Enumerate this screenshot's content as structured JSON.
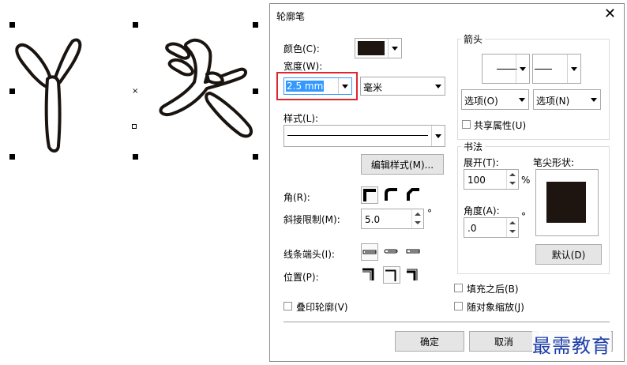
{
  "canvas": {
    "glyphs": [
      "丫",
      "头"
    ]
  },
  "dialog": {
    "title": "轮廓笔",
    "close": "✕"
  },
  "left": {
    "color_label": "颜色(C):",
    "width_label": "宽度(W):",
    "width_value": "2.5 mm",
    "unit_value": "毫米",
    "style_label": "样式(L):",
    "edit_style_button": "编辑样式(M)...",
    "corner_label": "角(R):",
    "miter_label": "斜接限制(M):",
    "miter_value": "5.0",
    "miter_unit": "°",
    "linecap_label": "线条端头(I):",
    "position_label": "位置(P):",
    "overprint_label": "叠印轮廓(V)"
  },
  "arrows": {
    "group_label": "箭头",
    "option_left": "选项(O)",
    "option_right": "选项(N)",
    "share_label": "共享属性(U)"
  },
  "calligraphy": {
    "group_label": "书法",
    "stretch_label": "展开(T):",
    "stretch_value": "100",
    "stretch_unit": "%",
    "angle_label": "角度(A):",
    "angle_value": ".0",
    "angle_unit": "°",
    "nib_label": "笔尖形状:",
    "default_button": "默认(D)"
  },
  "right_checks": {
    "fill_behind": "填充之后(B)",
    "scale_with_object": "随对象缩放(J)"
  },
  "footer": {
    "ok": "确定",
    "cancel": "取消"
  },
  "watermark": "最需教育",
  "colors": {
    "swatch": "#1e1410",
    "highlight_red": "#e0262c",
    "selection_blue": "#3399ff",
    "watermark_blue": "#1d3ea8"
  }
}
